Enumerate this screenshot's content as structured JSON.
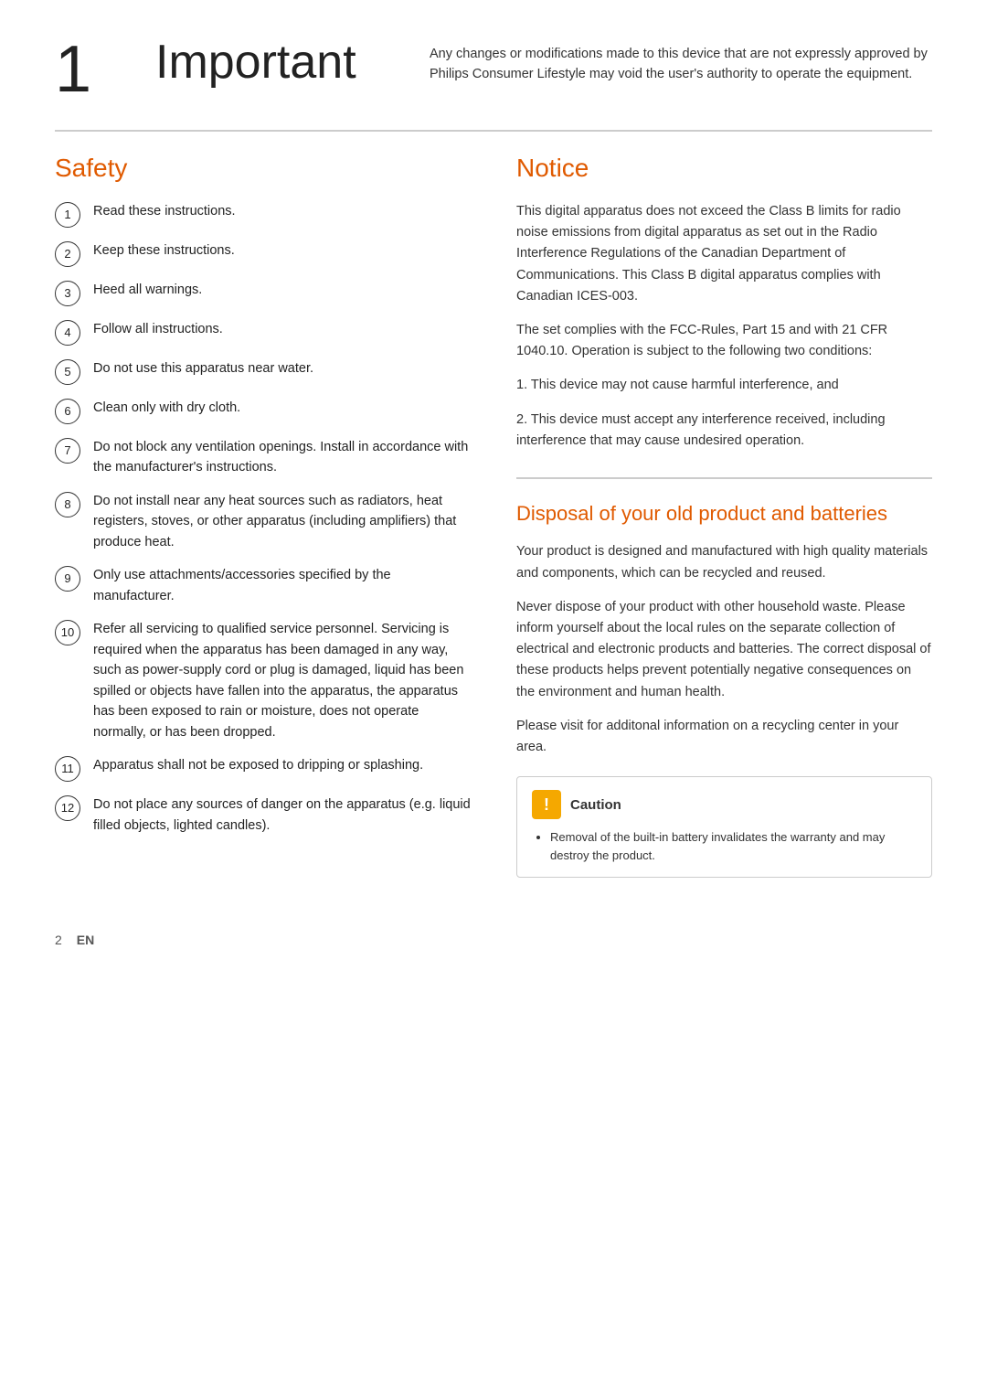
{
  "header": {
    "number": "1",
    "title": "Important",
    "body_text": "Any changes or modifications made to this device that are not expressly approved by Philips Consumer Lifestyle may void the user's authority to operate the equipment."
  },
  "safety": {
    "title": "Safety",
    "items": [
      {
        "number": "1",
        "text": "Read these instructions."
      },
      {
        "number": "2",
        "text": "Keep these instructions."
      },
      {
        "number": "3",
        "text": "Heed all warnings."
      },
      {
        "number": "4",
        "text": "Follow all instructions."
      },
      {
        "number": "5",
        "text": "Do not use this apparatus near water."
      },
      {
        "number": "6",
        "text": "Clean only with dry cloth."
      },
      {
        "number": "7",
        "text": "Do not block any ventilation openings. Install in accordance with the manufacturer's instructions."
      },
      {
        "number": "8",
        "text": "Do not install near any heat sources such as radiators, heat registers, stoves, or other apparatus (including amplifiers) that produce heat."
      },
      {
        "number": "9",
        "text": "Only use attachments/accessories specified by the manufacturer."
      },
      {
        "number": "10",
        "text": "Refer all servicing to qualified service personnel. Servicing is required when the apparatus has been damaged in any way, such as power-supply cord or plug is damaged, liquid has been spilled or objects have fallen into the apparatus, the apparatus has been exposed to rain or moisture, does not operate normally, or has been dropped."
      },
      {
        "number": "11",
        "text": "Apparatus shall not be exposed to dripping or splashing."
      },
      {
        "number": "12",
        "text": "Do not place any sources of danger on the apparatus (e.g. liquid filled objects, lighted candles)."
      }
    ]
  },
  "notice": {
    "title": "Notice",
    "paragraph1": "This digital apparatus does not exceed the Class B limits for radio noise emissions from digital apparatus as set out in the Radio Interference Regulations of the Canadian Department of Communications. This Class B digital apparatus complies with Canadian ICES-003.",
    "paragraph2": "The set complies with the FCC-Rules, Part 15 and with 21 CFR 1040.10. Operation is subject to the following two conditions:",
    "condition1": "1. This device may not cause harmful interference, and",
    "condition2": "2. This device must accept any interference received, including interference that may cause undesired operation."
  },
  "disposal": {
    "title": "Disposal of your old product and batteries",
    "paragraph1": "Your product is designed and manufactured with high quality materials and components, which can be recycled and reused.",
    "paragraph2": "Never dispose of your product with other household waste. Please inform yourself about the local rules on the separate collection of electrical and electronic products and batteries. The correct disposal of these products helps prevent potentially negative consequences on the environment and human health.",
    "paragraph3": "Please visit for additonal information on a recycling center in your area."
  },
  "caution": {
    "icon_label": "!",
    "label": "Caution",
    "items": [
      "Removal of the built-in battery invalidates the warranty and may destroy the product."
    ]
  },
  "footer": {
    "page_number": "2",
    "language": "EN"
  }
}
